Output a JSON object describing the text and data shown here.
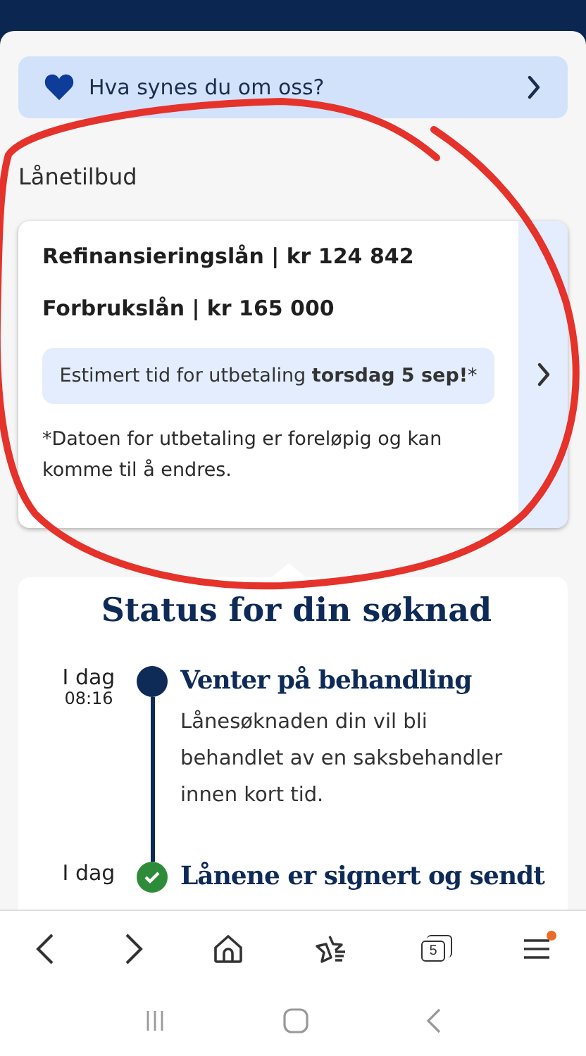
{
  "feedback_banner": {
    "label": "Hva synes du om oss?"
  },
  "section_title": "Lånetilbud",
  "offer_card": {
    "loans": [
      "Refinansieringslån | kr 124 842",
      "Forbrukslån | kr 165 000"
    ],
    "payout_note": "Estimert tid for utbetaling **torsdag 5 sep!***",
    "disclaimer": "*Datoen for utbetaling er foreløpig og kan komme til å endres."
  },
  "status": {
    "title": "Status for din søknad",
    "events": [
      {
        "day": "I dag",
        "time": "08:16",
        "title": "Venter på behandling",
        "text": "Lånesøknaden din vil bli behandlet av en saksbehandler innen kort tid.",
        "kind": "current"
      },
      {
        "day": "I dag",
        "title": "Lånene er signert og sendt",
        "kind": "done"
      }
    ]
  },
  "browser_toolbar": {
    "tab_count": "5",
    "menu_badge": true
  }
}
